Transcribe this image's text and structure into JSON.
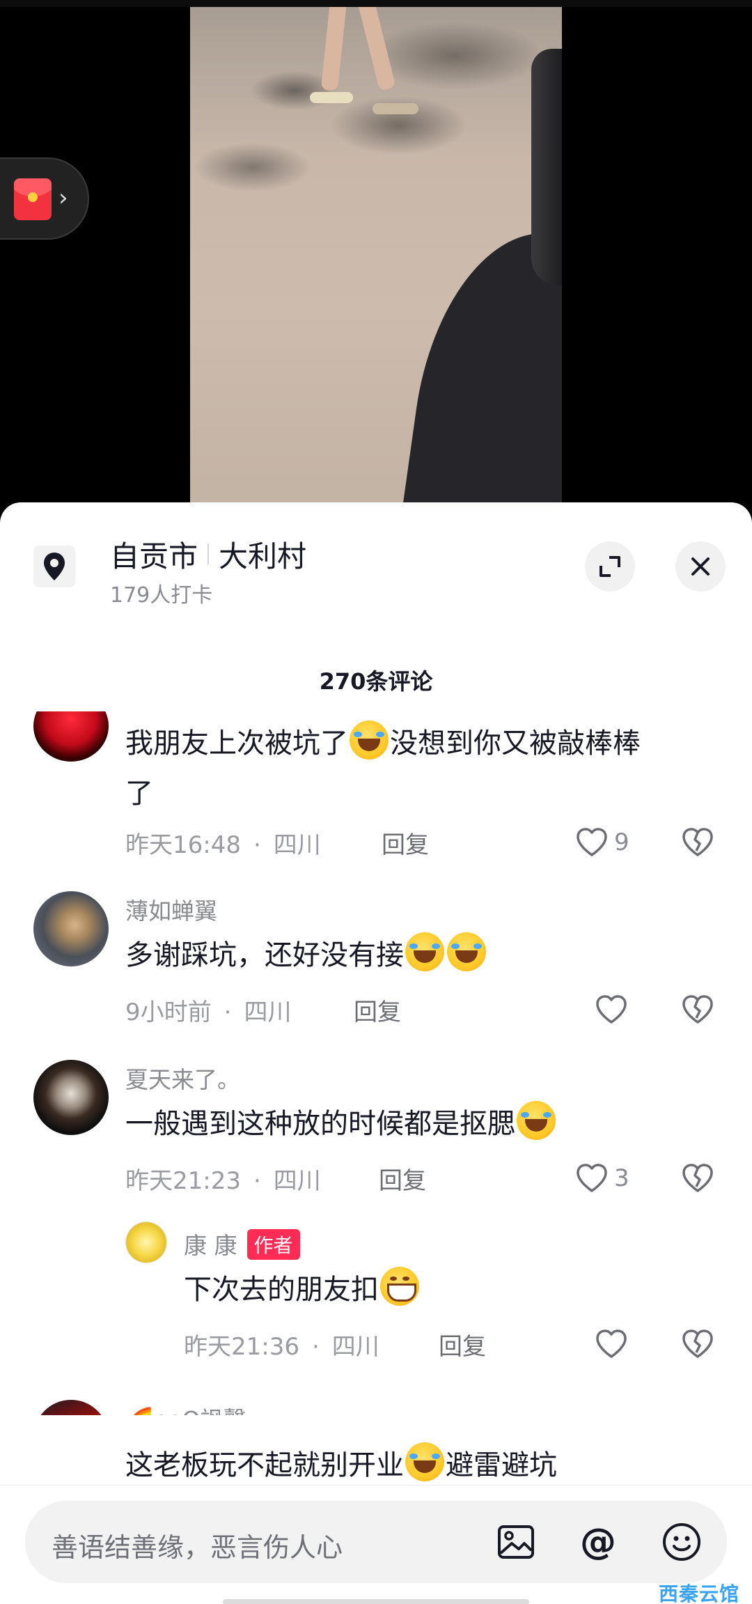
{
  "location": {
    "city": "自贡市",
    "village": "大利村",
    "checkins": "179人打卡"
  },
  "comments_header": {
    "count": "270条评论"
  },
  "comments": [
    {
      "line1": "我朋友上次被坑了",
      "line1_tail": "没想到你又被敲棒棒",
      "line2": "了",
      "time": "昨天16:48",
      "region": "四川",
      "reply": "回复",
      "likes": "9"
    },
    {
      "name": "薄如蝉翼",
      "text": "多谢踩坑，还好没有接",
      "time": "9小时前",
      "region": "四川",
      "reply": "回复"
    },
    {
      "name": "夏天来了。",
      "text": "一般遇到这种放的时候都是抠腮",
      "time": "昨天21:23",
      "region": "四川",
      "reply": "回复",
      "likes": "3"
    },
    {
      "name": "康 康",
      "badge": "作者",
      "text": "下次去的朋友扣",
      "time": "昨天21:36",
      "region": "四川",
      "reply": "回复"
    },
    {
      "name": "🌈ooO飒聲﹏. ∞",
      "text": "这老板玩不起就别开业",
      "text_tail": "避雷避坑"
    }
  ],
  "input": {
    "placeholder": "善语结善缘，恶言伤人心"
  },
  "watermark": "西秦云馆",
  "icons": {
    "location": "location-pin-icon",
    "expand": "expand-icon",
    "close": "close-icon",
    "like": "heart-icon",
    "dislike": "broken-heart-icon",
    "image": "image-icon",
    "mention": "at-icon",
    "emoji": "emoji-icon",
    "redpacket": "red-packet-icon"
  },
  "colors": {
    "accent": "#fe2c55",
    "text_primary": "#161823",
    "text_secondary": "#8a8b91"
  }
}
